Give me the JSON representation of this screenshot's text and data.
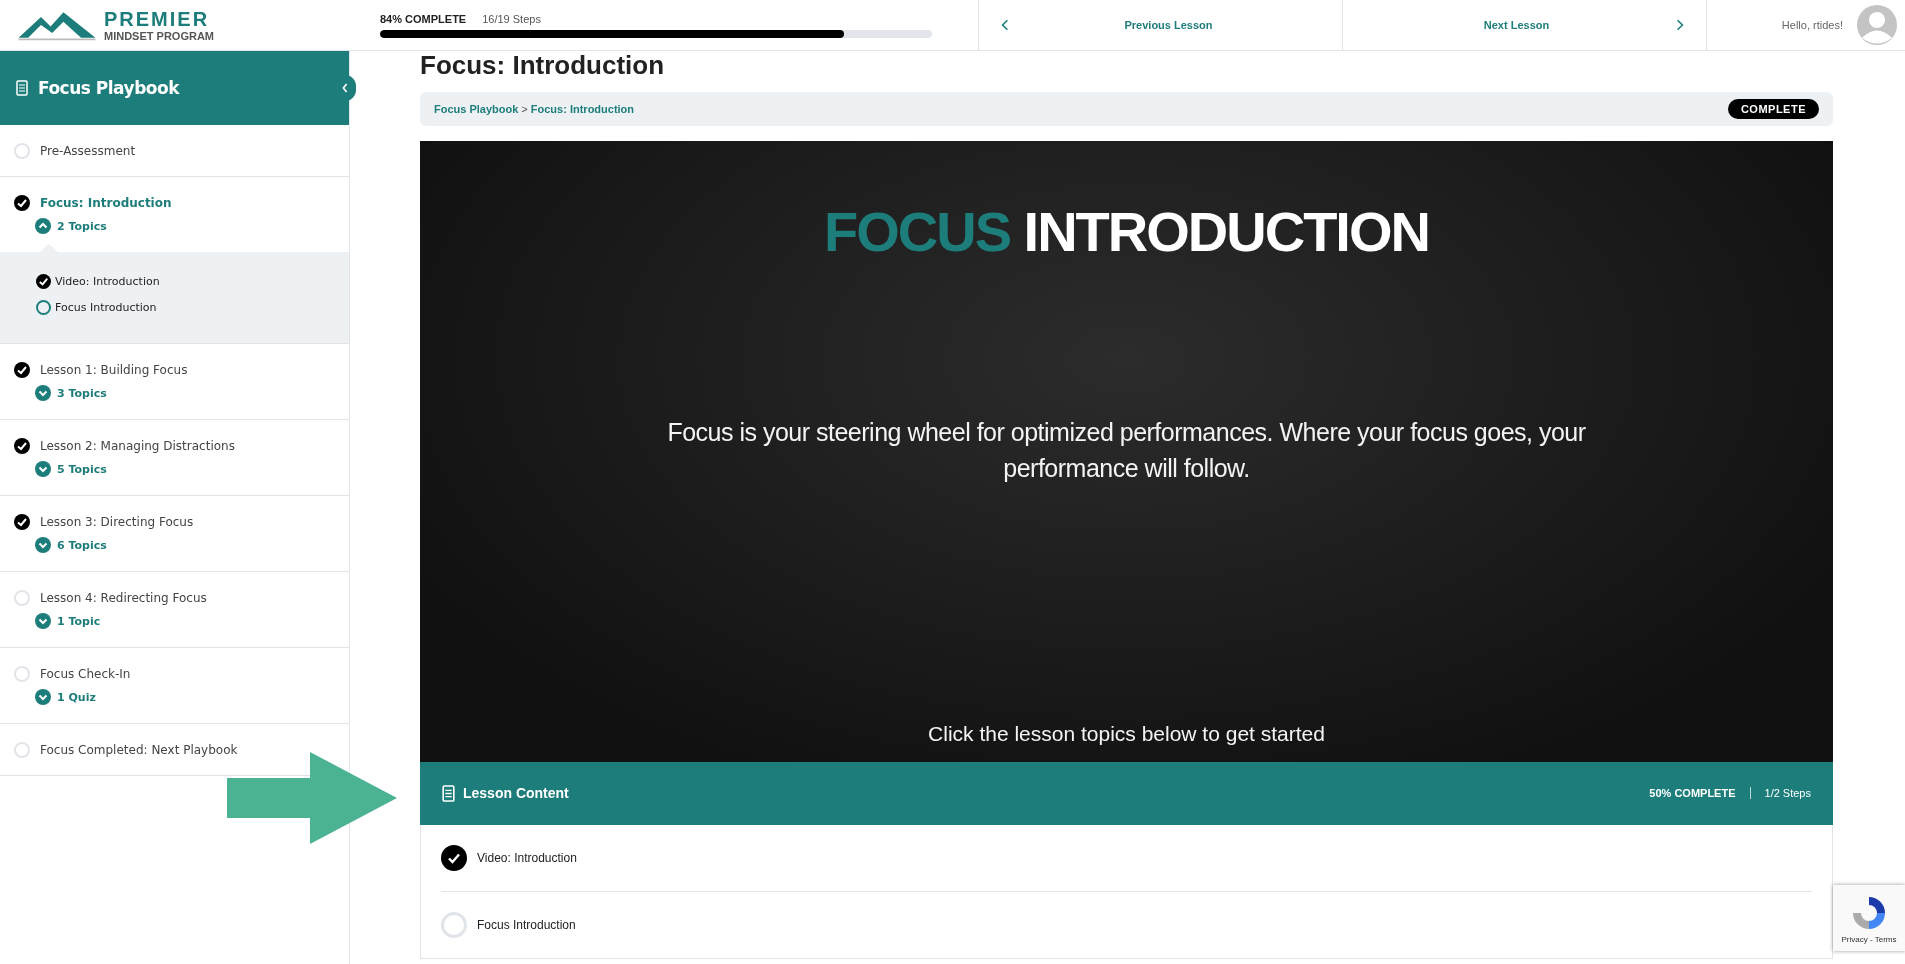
{
  "header": {
    "logo": {
      "line1": "PREMIER",
      "line2": "MINDSET PROGRAM"
    },
    "progress": {
      "percent_label": "84% COMPLETE",
      "steps": "16/19 Steps",
      "level": 0.84
    },
    "nav": {
      "previous": "Previous Lesson",
      "next": "Next Lesson"
    },
    "user": {
      "greeting": "Hello, rtides!"
    }
  },
  "sidebar": {
    "title": "Focus Playbook",
    "items": [
      {
        "title": "Pre-Assessment",
        "completed": false,
        "selected": false
      },
      {
        "title": "Focus: Introduction",
        "completed": true,
        "selected": true,
        "topics_label": "2 Topics",
        "expanded": true,
        "children": [
          {
            "title": "Video: Introduction",
            "completed": true
          },
          {
            "title": "Focus Introduction",
            "completed": false
          }
        ]
      },
      {
        "title": "Lesson 1: Building Focus",
        "completed": true,
        "selected": false,
        "topics_label": "3 Topics",
        "expanded": false
      },
      {
        "title": "Lesson 2: Managing Distractions",
        "completed": true,
        "selected": false,
        "topics_label": "5 Topics",
        "expanded": false
      },
      {
        "title": "Lesson 3: Directing Focus",
        "completed": true,
        "selected": false,
        "topics_label": "6 Topics",
        "expanded": false
      },
      {
        "title": "Lesson 4: Redirecting Focus",
        "completed": false,
        "selected": false,
        "topics_label": "1 Topic",
        "expanded": false
      },
      {
        "title": "Focus Check-In",
        "completed": false,
        "selected": false,
        "topics_label": "1 Quiz",
        "expanded": false
      },
      {
        "title": "Focus Completed: Next Playbook",
        "completed": false,
        "selected": false
      }
    ]
  },
  "main": {
    "title": "Focus: Introduction",
    "breadcrumb": [
      "Focus Playbook",
      "Focus: Introduction"
    ],
    "breadcrumb_separator": ">",
    "status_badge": "COMPLETE",
    "banner": {
      "heading_accent": "FOCUS",
      "heading": "INTRODUCTION",
      "body": "Focus is your steering wheel for optimized performances. Where your focus goes, your performance will follow.",
      "prompt": "Click the lesson topics below to get started"
    },
    "lesson_content": {
      "title": "Lesson Content",
      "percent_label": "50% COMPLETE",
      "steps": "1/2 Steps",
      "topics": [
        {
          "title": "Video: Introduction",
          "completed": true
        },
        {
          "title": "Focus Introduction",
          "completed": false
        }
      ]
    }
  },
  "recaptcha": {
    "text": "Privacy - Terms"
  }
}
